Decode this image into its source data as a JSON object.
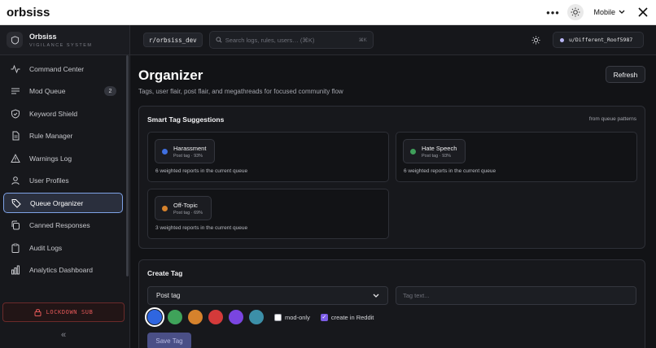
{
  "topbar": {
    "brand": "orbsiss",
    "device_label": "Mobile"
  },
  "sidebar": {
    "app_name": "Orbsiss",
    "app_tagline": "VIGILANCE SYSTEM",
    "items": [
      {
        "label": "Command Center",
        "icon": "activity-icon"
      },
      {
        "label": "Mod Queue",
        "icon": "list-icon",
        "badge": "2"
      },
      {
        "label": "Keyword Shield",
        "icon": "shield-icon"
      },
      {
        "label": "Rule Manager",
        "icon": "document-icon"
      },
      {
        "label": "Warnings Log",
        "icon": "warning-icon"
      },
      {
        "label": "User Profiles",
        "icon": "user-icon"
      },
      {
        "label": "Queue Organizer",
        "icon": "tag-icon",
        "active": true
      },
      {
        "label": "Canned Responses",
        "icon": "copy-icon"
      },
      {
        "label": "Audit Logs",
        "icon": "clipboard-icon"
      },
      {
        "label": "Analytics Dashboard",
        "icon": "bar-chart-icon"
      }
    ],
    "lockdown_label": "LOCKDOWN SUB",
    "collapse_glyph": "«"
  },
  "header": {
    "subreddit": "r/orbsiss_dev",
    "search_placeholder": "Search logs, rules, users… (⌘K)",
    "search_shortcut": "⌘K",
    "username": "u/Different_Roof5987"
  },
  "main": {
    "title": "Organizer",
    "subtitle": "Tags, user flair, post flair, and megathreads for focused community flow",
    "refresh_label": "Refresh"
  },
  "suggestions": {
    "title": "Smart Tag Suggestions",
    "hint": "from queue patterns",
    "items": [
      {
        "name": "Harassment",
        "meta": "Post tag · 93%",
        "desc": "6 weighted reports in the current queue",
        "color": "#3f6fe0"
      },
      {
        "name": "Hate Speech",
        "meta": "Post tag · 93%",
        "desc": "6 weighted reports in the current queue",
        "color": "#3f9f5a"
      },
      {
        "name": "Off-Topic",
        "meta": "Post tag · 69%",
        "desc": "3 weighted reports in the current queue",
        "color": "#d6822c"
      }
    ]
  },
  "create": {
    "title": "Create Tag",
    "type_value": "Post tag",
    "tag_placeholder": "Tag text...",
    "colors": [
      "#2f66e0",
      "#3fa35a",
      "#d6822c",
      "#d43a3a",
      "#7a45e0",
      "#3c8fa8"
    ],
    "mod_only_label": "mod-only",
    "mod_only_checked": false,
    "create_reddit_label": "create in Reddit",
    "create_reddit_checked": true,
    "save_label": "Save Tag"
  }
}
